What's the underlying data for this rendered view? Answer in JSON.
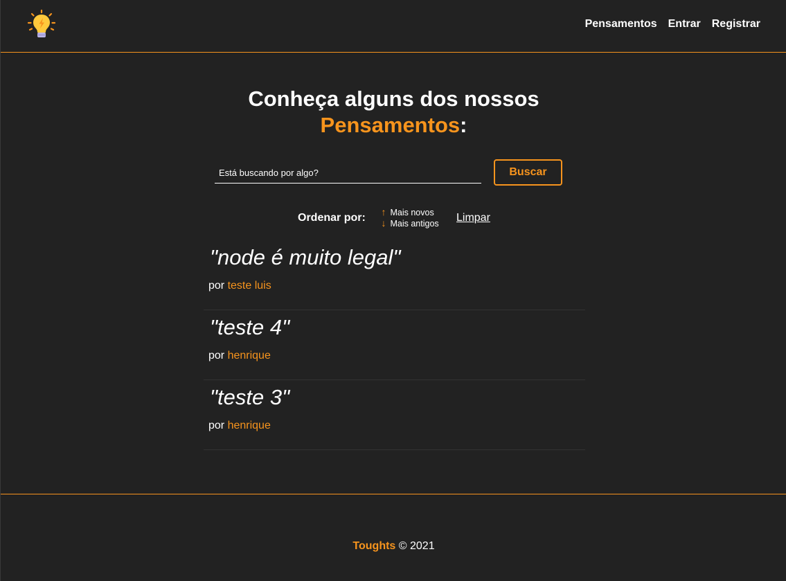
{
  "navbar": {
    "logo_icon": "lightbulb-icon",
    "links": [
      {
        "label": "Pensamentos"
      },
      {
        "label": "Entrar"
      },
      {
        "label": "Registrar"
      }
    ]
  },
  "heading": {
    "line1": "Conheça alguns dos nossos",
    "accent": "Pensamentos",
    "suffix": ":"
  },
  "search": {
    "placeholder": "Está buscando por algo?",
    "value": "",
    "button_label": "Buscar"
  },
  "order": {
    "label": "Ordenar por:",
    "newest_label": "Mais novos",
    "oldest_label": "Mais antigos",
    "clear_label": "Limpar"
  },
  "thoughts": [
    {
      "text": "\"node é muito legal\"",
      "by": "por",
      "author": "teste luis"
    },
    {
      "text": "\"teste 4\"",
      "by": "por",
      "author": "henrique"
    },
    {
      "text": "\"teste 3\"",
      "by": "por",
      "author": "henrique"
    }
  ],
  "footer": {
    "brand": "Toughts",
    "copyright": "© 2021"
  },
  "colors": {
    "background": "#222222",
    "accent": "#f7941d",
    "text": "#ffffff"
  }
}
